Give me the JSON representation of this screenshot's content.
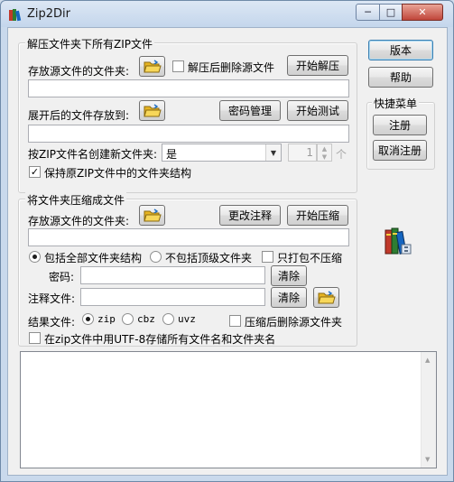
{
  "window": {
    "title": "Zip2Dir"
  },
  "unzip": {
    "group_title": "解压文件夹下所有ZIP文件",
    "source_label": "存放源文件的文件夹:",
    "delete_after_label": "解压后删除源文件",
    "delete_after_checked": false,
    "start_button": "开始解压",
    "dest_label": "展开后的文件存放到:",
    "password_button": "密码管理",
    "test_button": "开始测试",
    "create_folder_label": "按ZIP文件名创建新文件夹:",
    "create_folder_value": "是",
    "count_value": "1",
    "count_unit": "个",
    "keep_structure_label": "保持原ZIP文件中的文件夹结构",
    "keep_structure_checked": true
  },
  "zip": {
    "group_title": "将文件夹压缩成文件",
    "source_label": "存放源文件的文件夹:",
    "comment_button": "更改注释",
    "start_button": "开始压缩",
    "option_all_structure": "包括全部文件夹结构",
    "option_no_top": "不包括顶级文件夹",
    "option_store_only": "只打包不压缩",
    "password_label": "密码:",
    "clear_button": "清除",
    "comment_file_label": "注释文件:",
    "clear_button2": "清除",
    "result_label": "结果文件:",
    "formats": [
      "zip",
      "cbz",
      "uvz"
    ],
    "selected_format": "zip",
    "delete_after_label": "压缩后删除源文件夹",
    "utf8_label": "在zip文件中用UTF-8存储所有文件名和文件夹名"
  },
  "side": {
    "version_button": "版本",
    "help_button": "帮助",
    "shortcut_group": "快捷菜单",
    "register_button": "注册",
    "unregister_button": "取消注册"
  },
  "icons": {
    "app": "books-icon",
    "folder": "folder-open-icon",
    "logo": "books-logo-icon"
  }
}
